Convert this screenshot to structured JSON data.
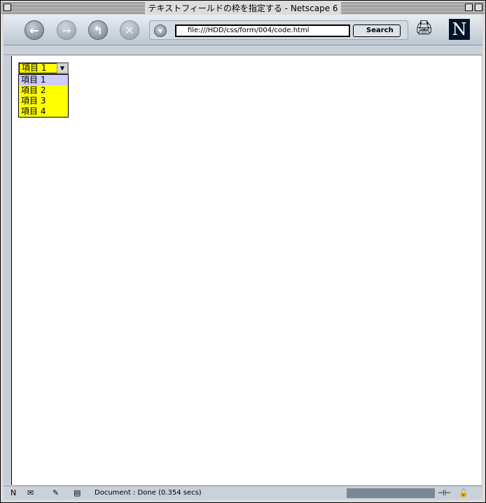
{
  "window": {
    "title": "テキストフィールドの枠を指定する - Netscape 6"
  },
  "toolbar": {
    "url": "file:///HDD/css/form/004/code.html",
    "search_label": "Search",
    "logo": "N"
  },
  "select": {
    "value": "項目 1",
    "options": [
      "項目 1",
      "項目 2",
      "項目 3",
      "項目 4"
    ],
    "highlighted": 0
  },
  "status": {
    "text": "Document : Done (0.354 secs)"
  }
}
